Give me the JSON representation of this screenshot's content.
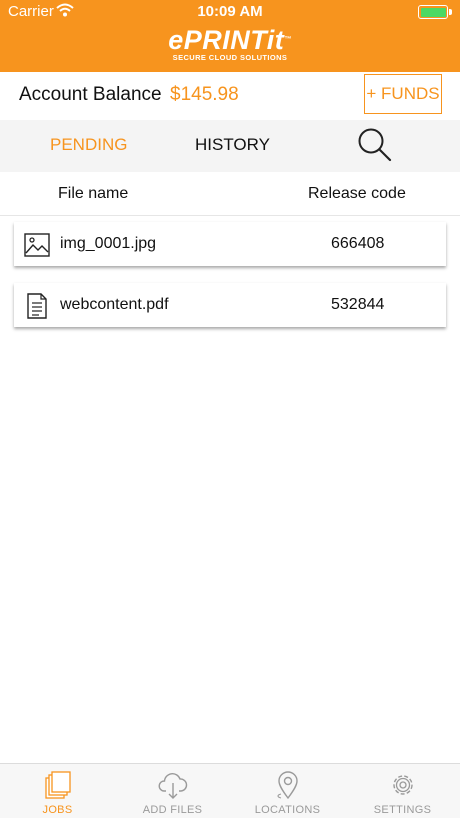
{
  "status_bar": {
    "carrier": "Carrier",
    "time": "10:09 AM"
  },
  "header": {
    "logo_text": "ePRINTit",
    "logo_tm": "™",
    "logo_tagline": "SECURE CLOUD SOLUTIONS",
    "brand_color": "#f7941e"
  },
  "account": {
    "balance_label": "Account Balance",
    "balance_amount": "$145.98",
    "funds_button": "+ FUNDS"
  },
  "tabs": {
    "pending": "PENDING",
    "history": "HISTORY",
    "active": "pending",
    "search_icon": "search-icon"
  },
  "table": {
    "col_file_name": "File name",
    "col_release_code": "Release code",
    "rows": [
      {
        "icon": "image-file-icon",
        "file_name": "img_0001.jpg",
        "release_code": "666408"
      },
      {
        "icon": "document-file-icon",
        "file_name": "webcontent.pdf",
        "release_code": "532844"
      }
    ]
  },
  "tabbar": {
    "items": [
      {
        "label": "JOBS",
        "icon": "jobs-icon",
        "active": true
      },
      {
        "label": "ADD FILES",
        "icon": "cloud-download-icon",
        "active": false
      },
      {
        "label": "LOCATIONS",
        "icon": "location-pin-icon",
        "active": false
      },
      {
        "label": "SETTINGS",
        "icon": "gear-icon",
        "active": false
      }
    ]
  }
}
